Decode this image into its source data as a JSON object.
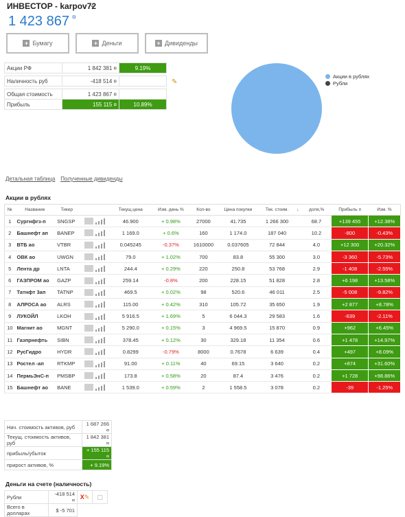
{
  "header": {
    "title": "ИНВЕСТОР - karpov72",
    "total": "1 423 867",
    "currency": "¤"
  },
  "buttons": {
    "paper": "Бумагу",
    "money": "Деньги",
    "dividends": "Дивиденды"
  },
  "summary": {
    "rows": [
      {
        "label": "Акции РФ",
        "value": "1 842 381 ¤",
        "pct": "9.19%"
      },
      {
        "label": "Наличность руб",
        "value": "-418 514 ¤",
        "pct": ""
      },
      {
        "label": "Общая стоимость",
        "value": "1 423 867 ¤",
        "pct": ""
      },
      {
        "label": "Прибыль",
        "value": "155 115 ¤",
        "pct": "10.89%"
      }
    ]
  },
  "pie": {
    "legend": [
      {
        "label": "Акции в рублях",
        "color": "#7cb5ec"
      },
      {
        "label": "Рубли",
        "color": "#434348"
      }
    ]
  },
  "links": {
    "detail": "Детальная таблица",
    "dividends": "Полученные дивиденды"
  },
  "stocks": {
    "title": "Акции в рублях",
    "headers": [
      "№",
      "Название",
      "Тикер",
      "",
      "Текущ.цена",
      "Изм. день %",
      "Кол-во",
      "Цена покупки",
      "Тек. стоим.",
      "↓",
      "доля,%",
      "Прибыль ¤",
      "Изм. %"
    ],
    "rows": [
      [
        "1",
        "Сургнфгз-п",
        "SNGSP",
        "46.900",
        "+ 0.98%",
        "27000",
        "41.735",
        "1 266 300",
        "68.7",
        "+139 455",
        "+12.38%"
      ],
      [
        "2",
        "Башнефт ап",
        "BANEP",
        "1 169.0",
        "+ 0.6%",
        "160",
        "1 174.0",
        "187 040",
        "10.2",
        "-800",
        "-0.43%"
      ],
      [
        "3",
        "ВТБ ао",
        "VTBR",
        "0.045245",
        "-0.37%",
        "1610000",
        "0.037605",
        "72 844",
        "4.0",
        "+12 300",
        "+20.32%"
      ],
      [
        "4",
        "ОВК ао",
        "UWGN",
        "79.0",
        "+ 1.02%",
        "700",
        "83.8",
        "55 300",
        "3.0",
        "-3 360",
        "-5.73%"
      ],
      [
        "5",
        "Лента др",
        "LNTA",
        "244.4",
        "+ 0.29%",
        "220",
        "250.8",
        "53 768",
        "2.9",
        "-1 408",
        "-2.55%"
      ],
      [
        "6",
        "ГАЗПРОМ ао",
        "GAZP",
        "259.14",
        "-0.8%",
        "200",
        "228.15",
        "51 828",
        "2.8",
        "+6 198",
        "+13.58%"
      ],
      [
        "7",
        "Татнфт 3ап",
        "TATNP",
        "469.5",
        "+ 0.02%",
        "98",
        "520.6",
        "46 011",
        "2.5",
        "-5 008",
        "-9.82%"
      ],
      [
        "8",
        "АЛРОСА ао",
        "ALRS",
        "115.00",
        "+ 0.42%",
        "310",
        "105.72",
        "35 650",
        "1.9",
        "+2 877",
        "+8.78%"
      ],
      [
        "9",
        "ЛУКОЙЛ",
        "LKOH",
        "5 916.5",
        "+ 1.69%",
        "5",
        "6 044.3",
        "29 583",
        "1.6",
        "-639",
        "-2.11%"
      ],
      [
        "10",
        "Магнит ао",
        "MGNT",
        "5 290.0",
        "+ 0.15%",
        "3",
        "4 969.5",
        "15 870",
        "0.9",
        "+962",
        "+6.45%"
      ],
      [
        "11",
        "Газпрнефть",
        "SIBN",
        "378.45",
        "+ 0.12%",
        "30",
        "329.18",
        "11 354",
        "0.6",
        "+1 478",
        "+14.97%"
      ],
      [
        "12",
        "РусГидро",
        "HYDR",
        "0.8299",
        "-0.79%",
        "8000",
        "0.7678",
        "6 639",
        "0.4",
        "+497",
        "+8.09%"
      ],
      [
        "13",
        "Ростел -ап",
        "RTKMP",
        "91.00",
        "+ 0.11%",
        "40",
        "69.15",
        "3 640",
        "0.2",
        "+874",
        "+31.60%"
      ],
      [
        "14",
        "ПермьЭнС-п",
        "PMSBP",
        "173.8",
        "+ 0.58%",
        "20",
        "87.4",
        "3 476",
        "0.2",
        "+1 728",
        "+98.86%"
      ],
      [
        "15",
        "Башнефт ао",
        "BANE",
        "1 539.0",
        "+ 0.59%",
        "2",
        "1 558.5",
        "3 078",
        "0.2",
        "-39",
        "-1.25%"
      ]
    ]
  },
  "totals": {
    "rows": [
      {
        "label": "Нач. стоимость активов, руб",
        "value": "1 687 266 ¤"
      },
      {
        "label": "Текущ. стоимость активов, руб",
        "value": "1 842 381 ¤"
      },
      {
        "label": "прибыль/убыток",
        "value": "+ 155 115 ¤"
      },
      {
        "label": "прирост активов, %",
        "value": "+ 9.19%"
      }
    ]
  },
  "cash": {
    "title": "Деньги на счете (наличность)",
    "rows": [
      {
        "label": "Рубли",
        "value": "-418 514 ¤"
      },
      {
        "label": "Всего в долларах",
        "value": "$ -5 701"
      }
    ]
  }
}
